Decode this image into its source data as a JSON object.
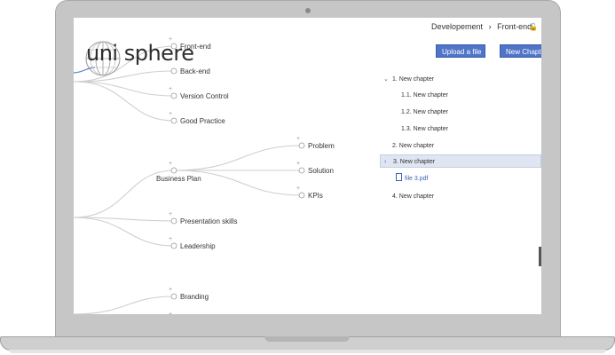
{
  "breadcrumb": {
    "parent": "Developement",
    "separator": "›",
    "current": "Front-end",
    "lock_icon": "lock-icon"
  },
  "logo": {
    "text": "uni sphere"
  },
  "toolbar": {
    "upload_label": "Upload a file",
    "new_chapter_label": "New Chapter"
  },
  "mindmap": {
    "nodes": {
      "frontend": "Front-end",
      "backend": "Back-end",
      "version": "Version Control",
      "practice": "Good Practice",
      "problem": "Problem",
      "solution": "Solution",
      "kpis": "KPIs",
      "business": "Business Plan",
      "presentation": "Presentation skills",
      "leadership": "Leadership",
      "branding": "Branding"
    },
    "plus": "+"
  },
  "tree": {
    "items": [
      {
        "label": "1.  New chapter"
      },
      {
        "label": "1.1.  New chapter"
      },
      {
        "label": "1.2.  New chapter"
      },
      {
        "label": "1.3.  New chapter"
      },
      {
        "label": "2.  New chapter"
      },
      {
        "label": "3.  New chapter"
      },
      {
        "label": "file 3.pdf"
      },
      {
        "label": "4.  New chapter"
      }
    ],
    "chevron_down": "⌄",
    "chevron_right": "›"
  },
  "colors": {
    "accent": "#4f74c8",
    "selected_row": "#dfe6f2"
  }
}
